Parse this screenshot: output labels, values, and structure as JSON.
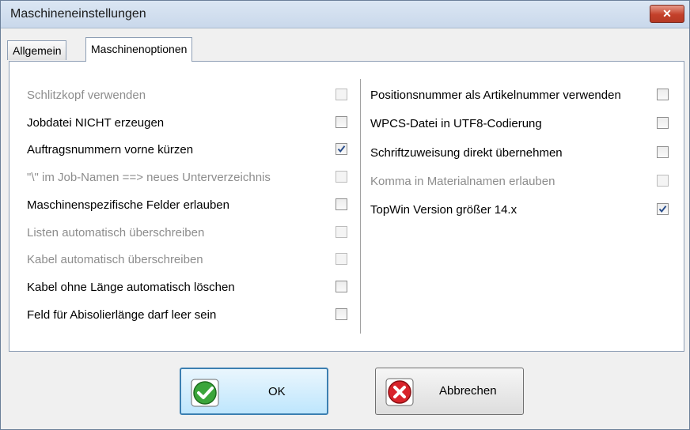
{
  "window": {
    "title": "Maschineneinstellungen",
    "close_glyph": "✕"
  },
  "tabs": [
    {
      "label": "Allgemein",
      "active": false
    },
    {
      "label": "Maschinenoptionen",
      "active": true
    }
  ],
  "left_options": [
    {
      "label": "Schlitzkopf verwenden",
      "checked": false,
      "enabled": false
    },
    {
      "label": "Jobdatei NICHT erzeugen",
      "checked": false,
      "enabled": true
    },
    {
      "label": "Auftragsnummern vorne kürzen",
      "checked": true,
      "enabled": true
    },
    {
      "label": "\"\\\" im Job-Namen ==> neues Unterverzeichnis",
      "checked": false,
      "enabled": false
    },
    {
      "label": "Maschinenspezifische Felder erlauben",
      "checked": false,
      "enabled": true
    },
    {
      "label": "Listen automatisch überschreiben",
      "checked": false,
      "enabled": false
    },
    {
      "label": "Kabel automatisch überschreiben",
      "checked": false,
      "enabled": false
    },
    {
      "label": "Kabel ohne Länge automatisch löschen",
      "checked": false,
      "enabled": true
    },
    {
      "label": "Feld für Abisolierlänge darf leer sein",
      "checked": false,
      "enabled": true
    }
  ],
  "right_options": [
    {
      "label": "Positionsnummer als Artikelnummer verwenden",
      "checked": false,
      "enabled": true
    },
    {
      "label": "WPCS-Datei in UTF8-Codierung",
      "checked": false,
      "enabled": true
    },
    {
      "label": "Schriftzuweisung direkt übernehmen",
      "checked": false,
      "enabled": true
    },
    {
      "label": "Komma in Materialnamen erlauben",
      "checked": false,
      "enabled": false
    },
    {
      "label": "TopWin Version größer 14.x",
      "checked": true,
      "enabled": true
    }
  ],
  "buttons": {
    "ok_label": "OK",
    "cancel_label": "Abbrechen"
  },
  "colors": {
    "ok_icon": "#3aa53a",
    "cancel_icon": "#d8232a",
    "check": "#2b4f8c"
  }
}
